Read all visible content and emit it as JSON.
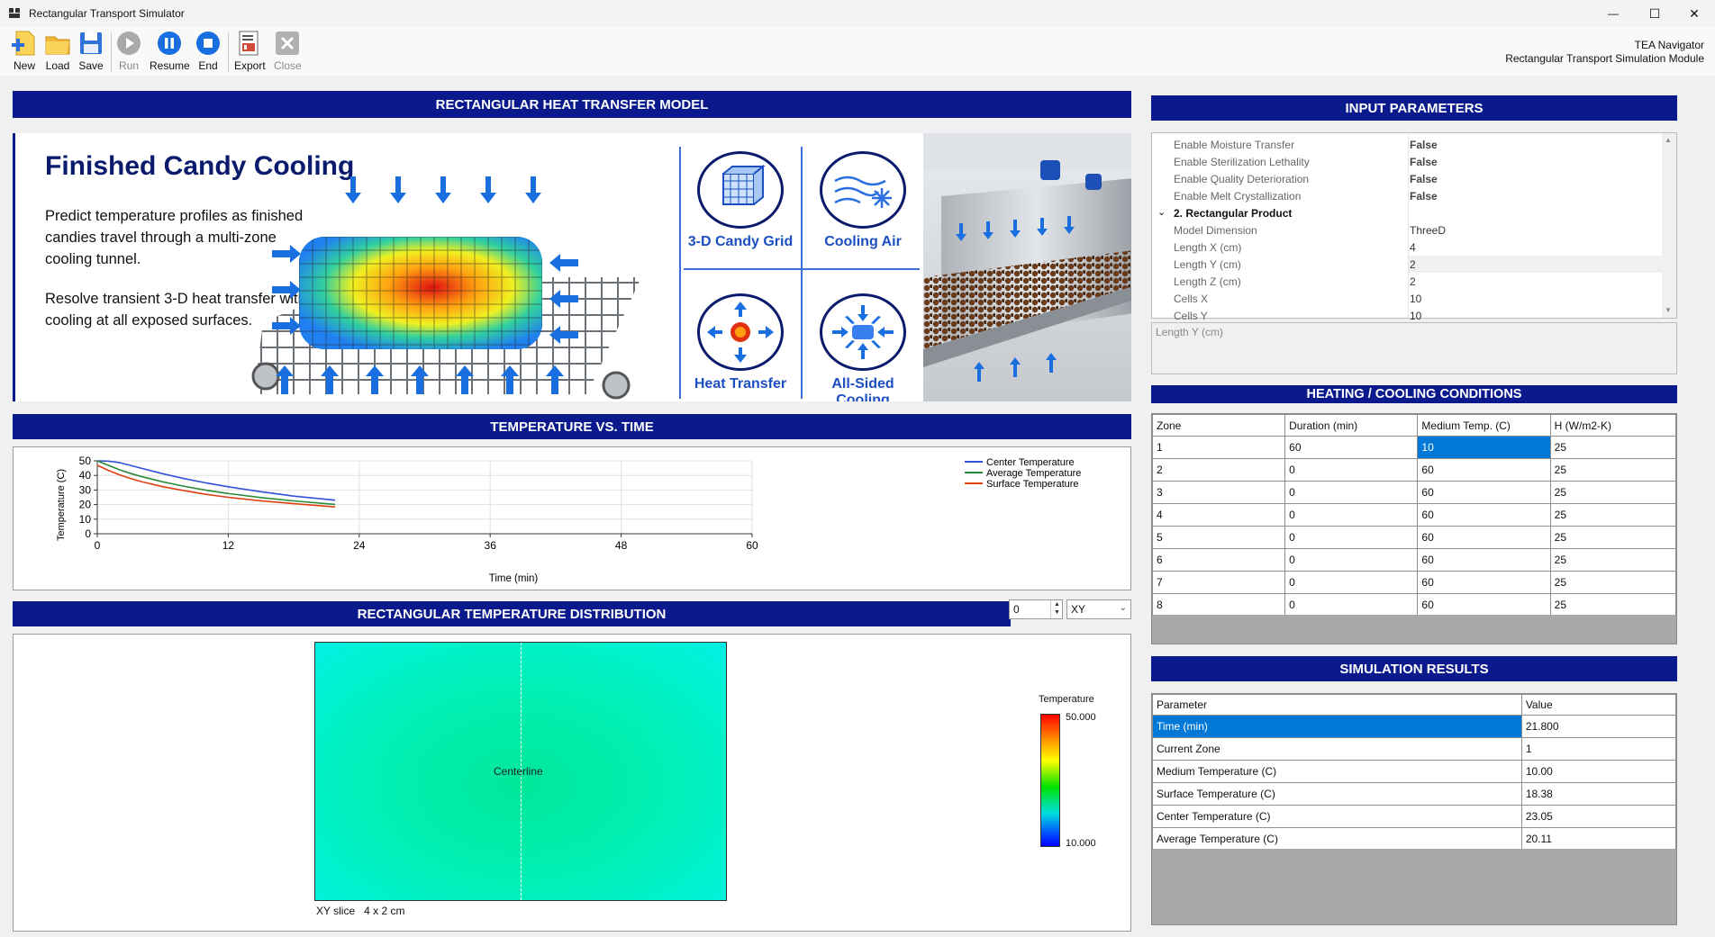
{
  "window": {
    "title": "Rectangular Transport Simulator",
    "minimize": "—",
    "maximize": "☐",
    "close": "✕"
  },
  "toolbar": {
    "new": "New",
    "load": "Load",
    "save": "Save",
    "run": "Run",
    "resume": "Resume",
    "end": "End",
    "export": "Export",
    "close": "Close"
  },
  "nav": {
    "line1": "TEA Navigator",
    "line2": "Rectangular Transport Simulation Module"
  },
  "headers": {
    "model": "RECTANGULAR HEAT TRANSFER MODEL",
    "chart": "TEMPERATURE VS. TIME",
    "dist": "RECTANGULAR TEMPERATURE DISTRIBUTION",
    "inputs": "INPUT PARAMETERS",
    "conditions": "HEATING / COOLING CONDITIONS",
    "results": "SIMULATION RESULTS"
  },
  "banner": {
    "title": "Finished Candy Cooling",
    "p1": "Predict temperature profiles as finished candies travel through a multi-zone cooling tunnel.",
    "p2": "Resolve transient 3-D heat transfer with cooling at all exposed surfaces.",
    "f1": "3-D Candy Grid",
    "f2": "Cooling Air",
    "f3": "Heat Transfer",
    "f4": "All-Sided Cooling"
  },
  "chart_data": {
    "type": "line",
    "xlabel": "Time (min)",
    "ylabel": "Temperature (C)",
    "xlim": [
      0,
      60
    ],
    "ylim": [
      0,
      50
    ],
    "xticks": [
      0,
      12,
      24,
      36,
      48,
      60
    ],
    "yticks": [
      0,
      10,
      20,
      30,
      40,
      50
    ],
    "legend_position": "top-right",
    "series": [
      {
        "name": "Center Temperature",
        "color": "#3050d8",
        "x": [
          0,
          1,
          2,
          3,
          4,
          6,
          8,
          10,
          12,
          15,
          18,
          21.8
        ],
        "y": [
          50,
          49.8,
          48.8,
          47.0,
          45.0,
          41.2,
          37.8,
          34.8,
          32.2,
          28.8,
          25.8,
          23.05
        ]
      },
      {
        "name": "Average Temperature",
        "color": "#2a8a3a",
        "x": [
          0,
          1,
          2,
          3,
          4,
          6,
          8,
          10,
          12,
          15,
          18,
          21.8
        ],
        "y": [
          50,
          47.0,
          44.0,
          41.5,
          39.3,
          35.6,
          32.5,
          29.8,
          27.6,
          24.8,
          22.5,
          20.11
        ]
      },
      {
        "name": "Surface Temperature",
        "color": "#e04010",
        "x": [
          0,
          1,
          2,
          3,
          4,
          6,
          8,
          10,
          12,
          15,
          18,
          21.8
        ],
        "y": [
          47,
          43.5,
          40.5,
          38.0,
          35.8,
          32.3,
          29.5,
          27.0,
          25.0,
          22.6,
          20.6,
          18.38
        ]
      }
    ]
  },
  "distribution": {
    "slice_value": "0",
    "plane": "XY",
    "centerline": "Centerline",
    "caption": "XY slice   4 x 2 cm",
    "colorbar_title": "Temperature",
    "colorbar_max": "50.000",
    "colorbar_min": "10.000"
  },
  "inputs": {
    "rows": [
      {
        "name": "Enable Moisture Transfer",
        "value": "False"
      },
      {
        "name": "Enable Sterilization Lethality",
        "value": "False"
      },
      {
        "name": "Enable Quality Deterioration",
        "value": "False"
      },
      {
        "name": "Enable Melt Crystallization",
        "value": "False"
      }
    ],
    "category": "2. Rectangular Product",
    "rows2": [
      {
        "name": "Model Dimension",
        "value": "ThreeD"
      },
      {
        "name": "Length X (cm)",
        "value": "4"
      },
      {
        "name": "Length Y (cm)",
        "value": "2"
      },
      {
        "name": "Length Z (cm)",
        "value": "2"
      },
      {
        "name": "Cells X",
        "value": "10"
      },
      {
        "name": "Cells Y",
        "value": "10"
      }
    ],
    "description": "Length Y (cm)"
  },
  "conditions": {
    "columns": [
      "Zone",
      "Duration (min)",
      "Medium Temp. (C)",
      "H (W/m2-K)"
    ],
    "rows": [
      [
        "1",
        "60",
        "10",
        "25"
      ],
      [
        "2",
        "0",
        "60",
        "25"
      ],
      [
        "3",
        "0",
        "60",
        "25"
      ],
      [
        "4",
        "0",
        "60",
        "25"
      ],
      [
        "5",
        "0",
        "60",
        "25"
      ],
      [
        "6",
        "0",
        "60",
        "25"
      ],
      [
        "7",
        "0",
        "60",
        "25"
      ],
      [
        "8",
        "0",
        "60",
        "25"
      ]
    ]
  },
  "results": {
    "columns": [
      "Parameter",
      "Value"
    ],
    "rows": [
      [
        "Time (min)",
        "21.800"
      ],
      [
        "Current Zone",
        "1"
      ],
      [
        "Medium Temperature (C)",
        "10.00"
      ],
      [
        "Surface Temperature (C)",
        "18.38"
      ],
      [
        "Center Temperature (C)",
        "23.05"
      ],
      [
        "Average Temperature (C)",
        "20.11"
      ]
    ]
  }
}
